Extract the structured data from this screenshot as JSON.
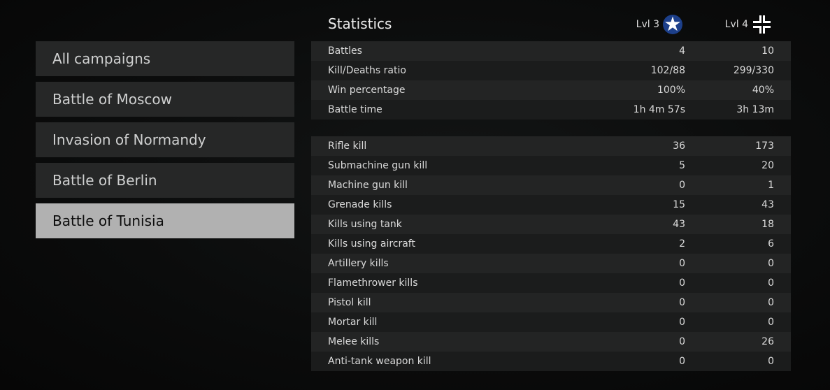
{
  "sidebar": {
    "items": [
      {
        "label": "All campaigns",
        "selected": false
      },
      {
        "label": "Battle of Moscow",
        "selected": false
      },
      {
        "label": "Invasion of Normandy",
        "selected": false
      },
      {
        "label": "Battle of Berlin",
        "selected": false
      },
      {
        "label": "Battle of Tunisia",
        "selected": true
      }
    ]
  },
  "header": {
    "title": "Statistics",
    "col1": {
      "level": "Lvl 3",
      "icon": "us-star-roundel-icon"
    },
    "col2": {
      "level": "Lvl 4",
      "icon": "balkenkreuz-icon"
    }
  },
  "general_stats": {
    "rows": [
      {
        "label": "Battles",
        "v1": "4",
        "v2": "10"
      },
      {
        "label": "Kill/Deaths ratio",
        "v1": "102/88",
        "v2": "299/330"
      },
      {
        "label": "Win percentage",
        "v1": "100%",
        "v2": "40%"
      },
      {
        "label": "Battle time",
        "v1": "1h 4m 57s",
        "v2": "3h 13m"
      }
    ]
  },
  "kill_stats": {
    "rows": [
      {
        "label": "Rifle kill",
        "v1": "36",
        "v2": "173"
      },
      {
        "label": "Submachine gun kill",
        "v1": "5",
        "v2": "20"
      },
      {
        "label": "Machine gun kill",
        "v1": "0",
        "v2": "1"
      },
      {
        "label": "Grenade kills",
        "v1": "15",
        "v2": "43"
      },
      {
        "label": "Kills using tank",
        "v1": "43",
        "v2": "18"
      },
      {
        "label": "Kills using aircraft",
        "v1": "2",
        "v2": "6"
      },
      {
        "label": "Artillery kills",
        "v1": "0",
        "v2": "0"
      },
      {
        "label": "Flamethrower kills",
        "v1": "0",
        "v2": "0"
      },
      {
        "label": "Pistol kill",
        "v1": "0",
        "v2": "0"
      },
      {
        "label": "Mortar kill",
        "v1": "0",
        "v2": "0"
      },
      {
        "label": "Melee kills",
        "v1": "0",
        "v2": "26"
      },
      {
        "label": "Anti-tank weapon kill",
        "v1": "0",
        "v2": "0"
      }
    ]
  },
  "colors": {
    "selected_bg": "#b1b1b1",
    "item_bg": "#262727",
    "roundel_blue": "#1c3f8a"
  }
}
